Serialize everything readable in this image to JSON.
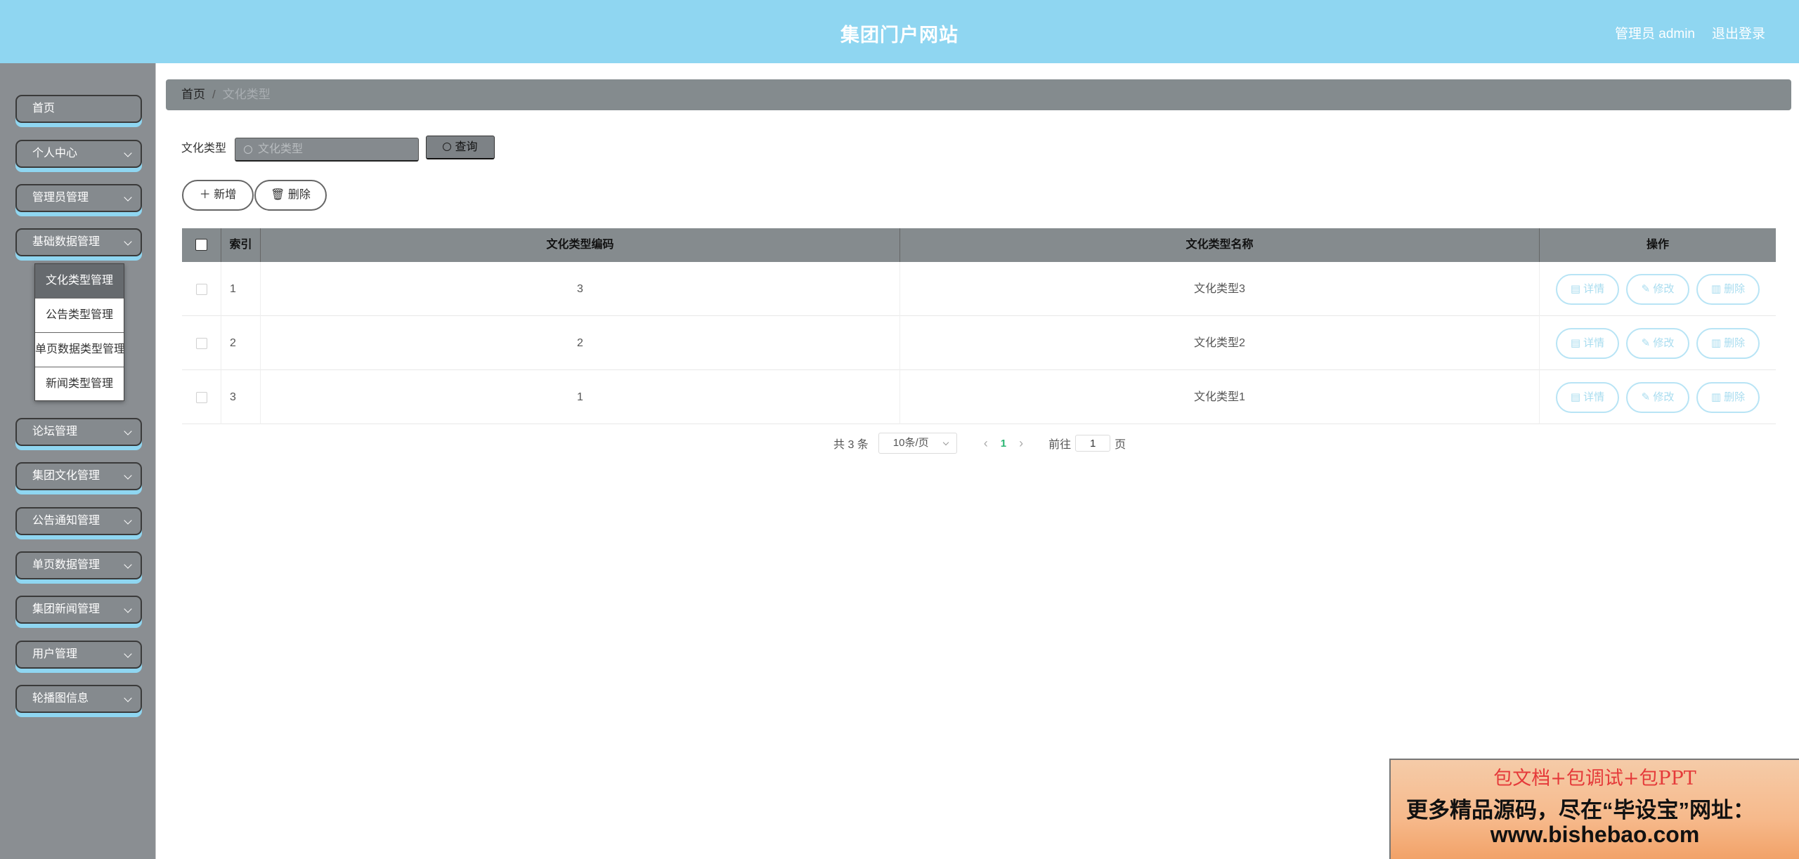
{
  "header": {
    "title": "集团门户网站",
    "user_label": "管理员 admin",
    "logout_label": "退出登录"
  },
  "sidebar": {
    "items": [
      {
        "label": "首页"
      },
      {
        "label": "个人中心"
      },
      {
        "label": "管理员管理"
      },
      {
        "label": "基础数据管理"
      },
      {
        "label": "论坛管理"
      },
      {
        "label": "集团文化管理"
      },
      {
        "label": "公告通知管理"
      },
      {
        "label": "单页数据管理"
      },
      {
        "label": "集团新闻管理"
      },
      {
        "label": "用户管理"
      },
      {
        "label": "轮播图信息"
      }
    ],
    "submenu": [
      {
        "label": "文化类型管理"
      },
      {
        "label": "公告类型管理"
      },
      {
        "label": "单页数据类型管理"
      },
      {
        "label": "新闻类型管理"
      }
    ]
  },
  "breadcrumb": {
    "home": "首页",
    "separator": "/",
    "current": "文化类型"
  },
  "search": {
    "label": "文化类型",
    "placeholder": "文化类型",
    "query_label": "查询"
  },
  "actions": {
    "add_label": "新增",
    "delete_label": "删除"
  },
  "table": {
    "headers": [
      "索引",
      "文化类型编码",
      "文化类型名称",
      "操作"
    ],
    "rows": [
      {
        "index": "1",
        "code": "3",
        "name": "文化类型3"
      },
      {
        "index": "2",
        "code": "2",
        "name": "文化类型2"
      },
      {
        "index": "3",
        "code": "1",
        "name": "文化类型1"
      }
    ],
    "row_actions": {
      "detail": "详情",
      "edit": "修改",
      "delete": "删除"
    }
  },
  "pagination": {
    "total": "共 3 条",
    "page_size": "10条/页",
    "current_page": "1",
    "goto_prefix": "前往",
    "goto_value": "1",
    "goto_suffix": "页"
  },
  "ad": {
    "line1": "包文档+包调试+包PPT",
    "line2": "更多精品源码，尽在“毕设宝”网址：",
    "line3": "www.bishebao.com"
  },
  "colors": {
    "header_bg": "#8fd6f1",
    "sidebar_bg": "#8a8e92",
    "accent_shadow": "#8fd6f1",
    "row_action": "#a8dcef",
    "page_active": "#2bb673"
  }
}
